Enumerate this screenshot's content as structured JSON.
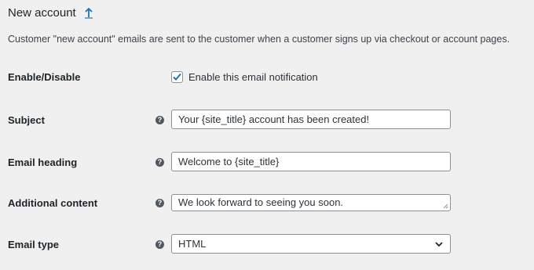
{
  "header": {
    "title": "New account",
    "up_icon": "arrow-up-icon"
  },
  "description": "Customer \"new account\" emails are sent to the customer when a customer signs up via checkout or account pages.",
  "fields": {
    "enable": {
      "label": "Enable/Disable",
      "checkbox_label": "Enable this email notification",
      "checked": true
    },
    "subject": {
      "label": "Subject",
      "value": "Your {site_title} account has been created!"
    },
    "heading": {
      "label": "Email heading",
      "value": "Welcome to {site_title}"
    },
    "additional": {
      "label": "Additional content",
      "value": "We look forward to seeing you soon."
    },
    "type": {
      "label": "Email type",
      "value": "HTML"
    }
  },
  "colors": {
    "background": "#f0f0f1",
    "accent": "#2271b1",
    "border": "#8c8f94"
  }
}
